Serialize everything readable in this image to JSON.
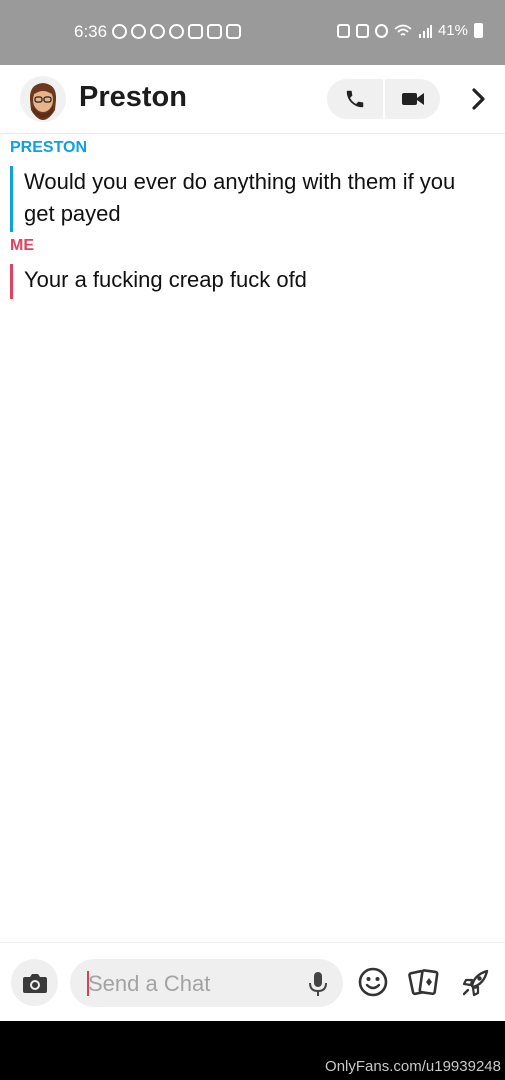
{
  "status_bar": {
    "time": "6:36",
    "battery": "41%",
    "app_icons": [
      "facebook-icon",
      "facebook-icon",
      "messenger-icon",
      "messenger-icon",
      "instagram-icon",
      "instagram-icon",
      "gallery-icon"
    ],
    "system_icons": [
      "nfc-icon",
      "vibrate-icon",
      "alarm-icon",
      "wifi-icon",
      "signal-icon",
      "battery-icon"
    ]
  },
  "header": {
    "name": "Preston",
    "icons": {
      "call": "phone-icon",
      "video": "video-camera-icon",
      "next": "chevron-right-icon"
    }
  },
  "messages": [
    {
      "sender": "PRESTON",
      "text": "Would you ever do anything with them if you get payed",
      "color": "#0ea0e0"
    },
    {
      "sender": "ME",
      "text": "Your a fucking creap fuck ofd",
      "color": "#e0425f"
    }
  ],
  "composer": {
    "placeholder": "Send a Chat",
    "value": "",
    "icons": [
      "camera-icon",
      "microphone-icon",
      "smiley-icon",
      "cards-icon",
      "rocket-icon"
    ]
  },
  "watermark": "OnlyFans.com/u19939248"
}
